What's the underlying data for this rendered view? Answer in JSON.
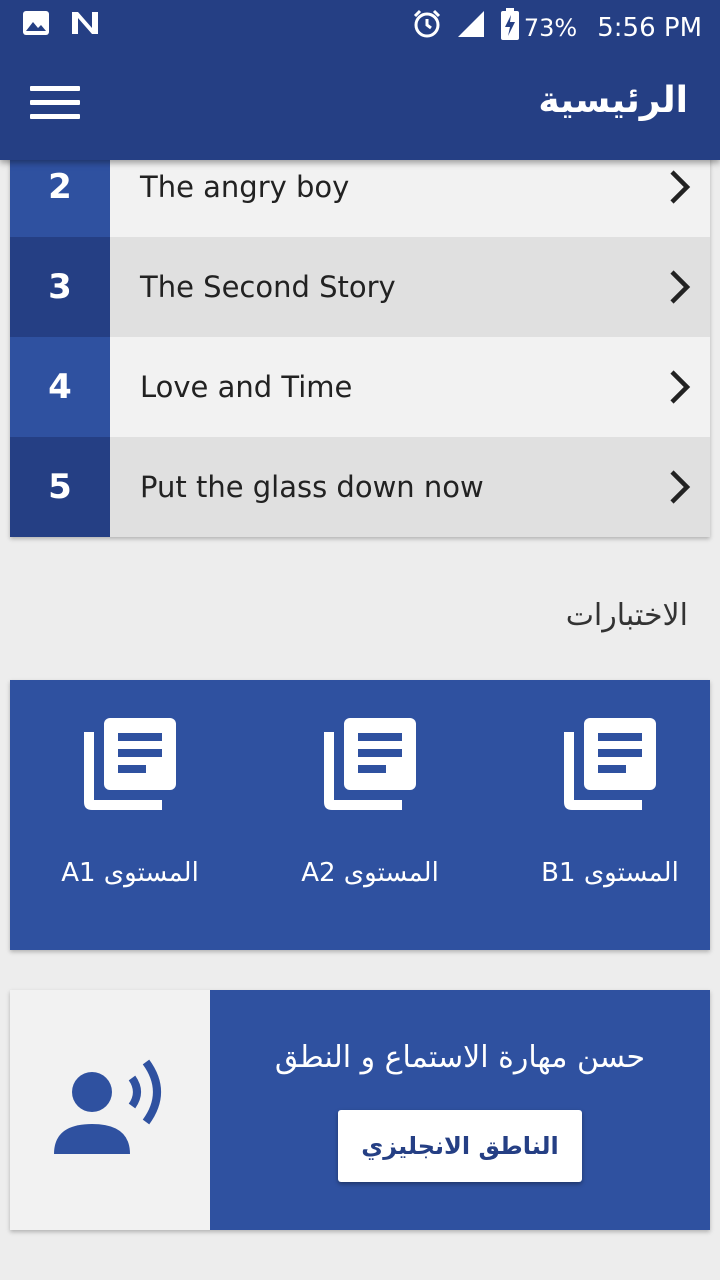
{
  "status_bar": {
    "left_icons": [
      "image-icon",
      "n-notification-icon"
    ],
    "right_icons": [
      "alarm-icon",
      "signal-icon",
      "battery-charging-icon"
    ],
    "battery": "73%",
    "time": "5:56 PM"
  },
  "app_bar": {
    "title": "الرئيسية",
    "menu_icon": "hamburger-menu-icon"
  },
  "stories": [
    {
      "number": "2",
      "title": "The angry boy"
    },
    {
      "number": "3",
      "title": "The Second Story"
    },
    {
      "number": "4",
      "title": "Love and Time"
    },
    {
      "number": "5",
      "title": "Put the glass down now"
    }
  ],
  "tests_section": {
    "heading": "الاختبارات",
    "items": [
      {
        "label": "المستوى B1",
        "icon": "library-books-icon"
      },
      {
        "label": "المستوى A2",
        "icon": "library-books-icon"
      },
      {
        "label": "المستوى A1",
        "icon": "library-books-icon"
      }
    ]
  },
  "speaker_card": {
    "icon": "record-voice-icon",
    "text": "حسن مهارة الاستماع و النطق",
    "button_label": "الناطق الانجليزي"
  },
  "colors": {
    "primary_dark": "#253f84",
    "primary": "#2f51a0",
    "row_light": "#f2f2f2",
    "row_dark": "#e0e0e0",
    "background": "#ededed"
  }
}
